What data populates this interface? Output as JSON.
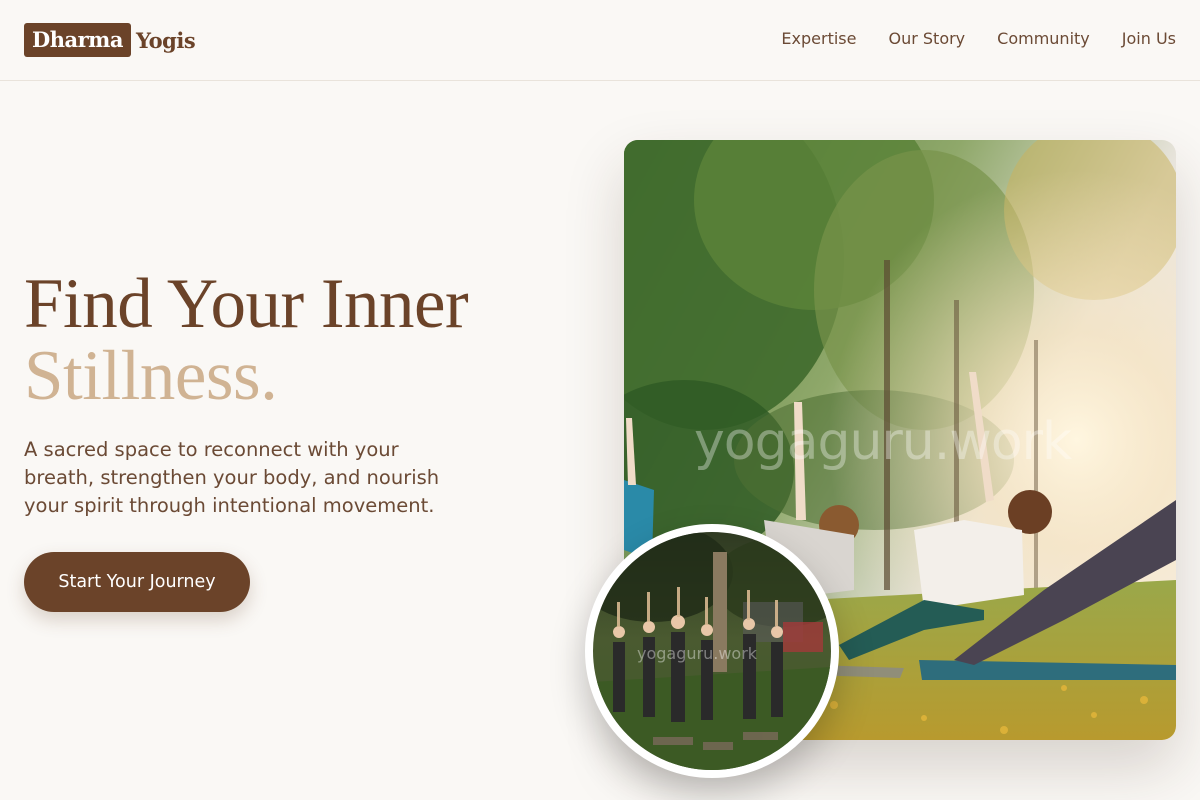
{
  "brand": {
    "highlight": "Dharma",
    "rest": "Yogis"
  },
  "nav": {
    "items": [
      {
        "label": "Expertise"
      },
      {
        "label": "Our Story"
      },
      {
        "label": "Community"
      },
      {
        "label": "Join Us"
      }
    ]
  },
  "hero": {
    "title_line1": "Find Your Inner",
    "title_line2": "Stillness.",
    "description": "A sacred space to reconnect with your breath, strengthen your body, and nourish your spirit through intentional movement.",
    "cta_label": "Start Your Journey"
  },
  "images": {
    "main_watermark": "yogaguru.work",
    "inset_watermark": "yogaguru.work",
    "main_alt_icon": "outdoor-yoga-class-photo",
    "inset_alt_icon": "group-yoga-park-photo"
  },
  "colors": {
    "brand_brown": "#6b4329",
    "accent_tan": "#d0b393",
    "background": "#faf8f5"
  }
}
